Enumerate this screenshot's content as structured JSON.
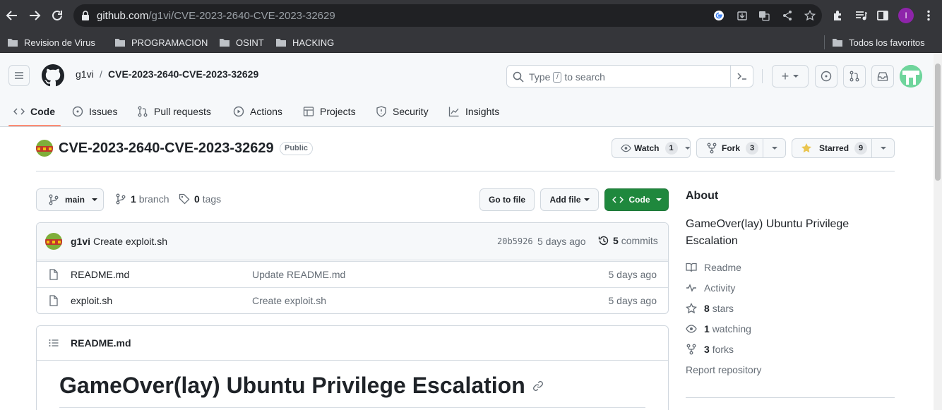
{
  "browser": {
    "url_host": "github.com",
    "url_path": "/g1vi/CVE-2023-2640-CVE-2023-32629",
    "profile_initial": "I",
    "bookmarks": [
      {
        "label": "Revision de Virus"
      },
      {
        "label": "PROGRAMACION"
      },
      {
        "label": "OSINT"
      },
      {
        "label": "HACKING"
      }
    ],
    "all_bookmarks_label": "Todos los favoritos"
  },
  "header": {
    "owner": "g1vi",
    "separator": "/",
    "repo": "CVE-2023-2640-CVE-2023-32629",
    "search_type": "Type",
    "search_key": "/",
    "search_rest": "to search",
    "add_label": "+"
  },
  "nav": {
    "tabs": [
      {
        "label": "Code",
        "icon": "code-icon"
      },
      {
        "label": "Issues",
        "icon": "issues-icon"
      },
      {
        "label": "Pull requests",
        "icon": "pull-request-icon"
      },
      {
        "label": "Actions",
        "icon": "play-icon"
      },
      {
        "label": "Projects",
        "icon": "table-icon"
      },
      {
        "label": "Security",
        "icon": "shield-icon"
      },
      {
        "label": "Insights",
        "icon": "graph-icon"
      }
    ]
  },
  "repo": {
    "title": "CVE-2023-2640-CVE-2023-32629",
    "visibility": "Public",
    "watch_label": "Watch",
    "watch_count": "1",
    "fork_label": "Fork",
    "fork_count": "3",
    "star_label": "Starred",
    "star_count": "9"
  },
  "files": {
    "branch": "main",
    "branch_count": "1",
    "branch_word": "branch",
    "tag_count": "0",
    "tag_word": "tags",
    "goto_label": "Go to file",
    "addfile_label": "Add file",
    "code_label": "Code",
    "commit": {
      "author": "g1vi",
      "message": "Create exploit.sh",
      "sha": "20b5926",
      "age": "5 days ago",
      "count": "5",
      "count_word": "commits"
    },
    "rows": [
      {
        "name": "README.md",
        "message": "Update README.md",
        "age": "5 days ago"
      },
      {
        "name": "exploit.sh",
        "message": "Create exploit.sh",
        "age": "5 days ago"
      }
    ]
  },
  "readme": {
    "filename": "README.md",
    "heading": "GameOver(lay) Ubuntu Privilege Escalation"
  },
  "about": {
    "title": "About",
    "description": "GameOver(lay) Ubuntu Privilege Escalation",
    "readme_label": "Readme",
    "activity_label": "Activity",
    "stars_count": "8",
    "stars_word": "stars",
    "watching_count": "1",
    "watching_word": "watching",
    "forks_count": "3",
    "forks_word": "forks",
    "report_label": "Report repository"
  },
  "colors": {
    "accent_green": "#1f883d",
    "nav_underline": "#fd8c73",
    "chrome_bg": "#35363a"
  }
}
